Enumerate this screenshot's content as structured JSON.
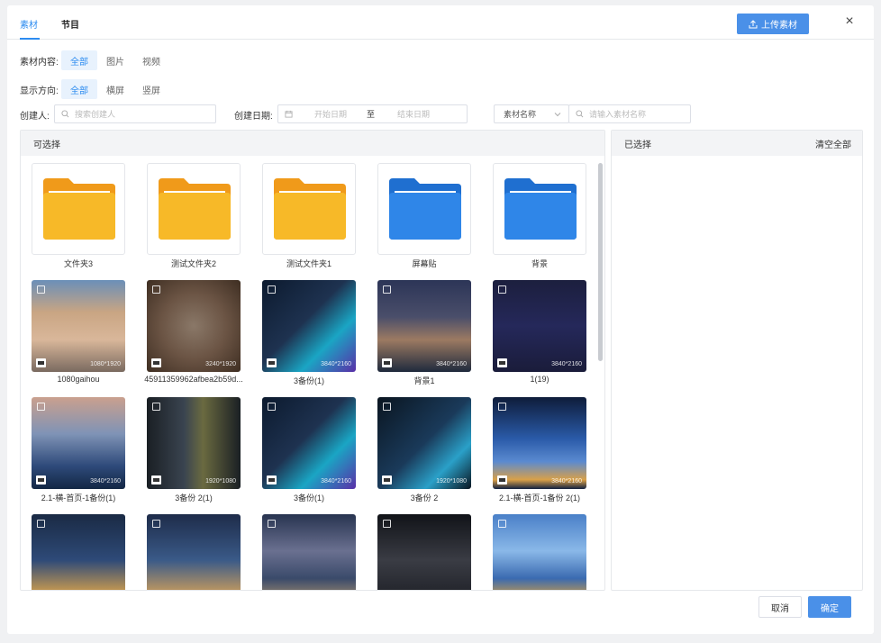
{
  "tabs": [
    {
      "label": "素材"
    },
    {
      "label": "节目"
    }
  ],
  "header": {
    "upload_label": "上传素材"
  },
  "filters": {
    "content": {
      "label": "素材内容:",
      "options": [
        "全部",
        "图片",
        "视频"
      ],
      "selected": "全部"
    },
    "direction": {
      "label": "显示方向:",
      "options": [
        "全部",
        "横屏",
        "竖屏"
      ],
      "selected": "全部"
    }
  },
  "search": {
    "creator_label": "创建人:",
    "creator_placeholder": "搜索创建人",
    "date_label": "创建日期:",
    "date_start_placeholder": "开始日期",
    "date_sep": "至",
    "date_end_placeholder": "结束日期",
    "name_select": "素材名称",
    "name_placeholder": "请输入素材名称"
  },
  "left_panel": {
    "title": "可选择"
  },
  "right_panel": {
    "title": "已选择",
    "clear_label": "清空全部"
  },
  "folders": [
    {
      "name": "文件夹3",
      "color": "#f7b928"
    },
    {
      "name": "测试文件夹2",
      "color": "#f7b928"
    },
    {
      "name": "测试文件夹1",
      "color": "#f7b928"
    },
    {
      "name": "屏幕贴",
      "color": "#2f86e8"
    },
    {
      "name": "背景",
      "color": "#2f86e8"
    }
  ],
  "media": [
    {
      "name": "1080gaihou",
      "resolution": "1080*1920",
      "bg": "linear-gradient(180deg,#6b8fb8 0%,#c9a583 35%,#d9b79a 65%,#7a6a60 100%)"
    },
    {
      "name": "45911359962afbea2b59d...",
      "resolution": "3240*1920",
      "bg": "radial-gradient(circle at 50% 50%,#8a7868 0%,#6b5444 50%,#3e2e22 100%)"
    },
    {
      "name": "3备份(1)",
      "resolution": "3840*2160",
      "bg": "linear-gradient(135deg,#0c1a2e 0%,#1e3250 45%,#1aa5c4 70%,#5a2fa8 100%)"
    },
    {
      "name": "背景1",
      "resolution": "3840*2160",
      "bg": "linear-gradient(180deg,#2c3557 0%,#4a4e6a 40%,#9c7a62 65%,#1f2a3d 100%)"
    },
    {
      "name": "1(19)",
      "resolution": "3840*2160",
      "bg": "linear-gradient(180deg,#1c1f3e 0%,#25285a 50%,#1a1c3a 100%)"
    },
    {
      "name": "2.1-横-首页-1备份(1)",
      "resolution": "3840*2160",
      "bg": "linear-gradient(180deg,#caa08e 0%,#7f93b6 40%,#2e4a7a 75%,#132744 100%)"
    },
    {
      "name": "3备份 2(1)",
      "resolution": "1920*1080",
      "bg": "linear-gradient(90deg,#1a1f24 0%,#3a4450 40%,#6a6a40 60%,#1a1f24 100%)"
    },
    {
      "name": "3备份(1)",
      "resolution": "3840*2160",
      "bg": "linear-gradient(135deg,#0c1a2e 0%,#1e3250 45%,#1aa5c4 70%,#5a2fa8 100%)"
    },
    {
      "name": "3备份 2",
      "resolution": "1920*1080",
      "bg": "linear-gradient(135deg,#0a1520 0%,#1a3a5a 50%,#2aa0c8 75%,#0a1520 100%)"
    },
    {
      "name": "2.1-横-首页-1备份 2(1)",
      "resolution": "3840*2160",
      "bg": "linear-gradient(180deg,#0e1c3a 0%,#2a5aa8 45%,#5a8ad0 70%,#d9a048 90%,#102040 100%)"
    },
    {
      "name": "",
      "resolution": "",
      "bg": "linear-gradient(180deg,#1a2a44 0%,#2e4a78 50%,#c89a50 85%,#1a2a44 100%)"
    },
    {
      "name": "",
      "resolution": "",
      "bg": "linear-gradient(180deg,#1e2c4a 0%,#3a5a88 50%,#c09860 85%,#20304c 100%)"
    },
    {
      "name": "",
      "resolution": "",
      "bg": "linear-gradient(180deg,#283450 0%,#6a7090 40%,#3a4a6a 70%,#c0a070 100%)"
    },
    {
      "name": "",
      "resolution": "",
      "bg": "linear-gradient(180deg,#111318 0%,#3a3c44 50%,#1a1c22 100%)"
    },
    {
      "name": "",
      "resolution": "",
      "bg": "linear-gradient(180deg,#4a80c8 0%,#8ab8e8 40%,#3a6ab0 70%,#d8a040 92%)"
    }
  ],
  "footer": {
    "cancel_label": "取消",
    "ok_label": "确定"
  },
  "colors": {
    "accent": "#2d8cf0",
    "primary_button": "#4a90e8",
    "folder_yellow": "#f7b928",
    "folder_blue": "#2f86e8"
  }
}
